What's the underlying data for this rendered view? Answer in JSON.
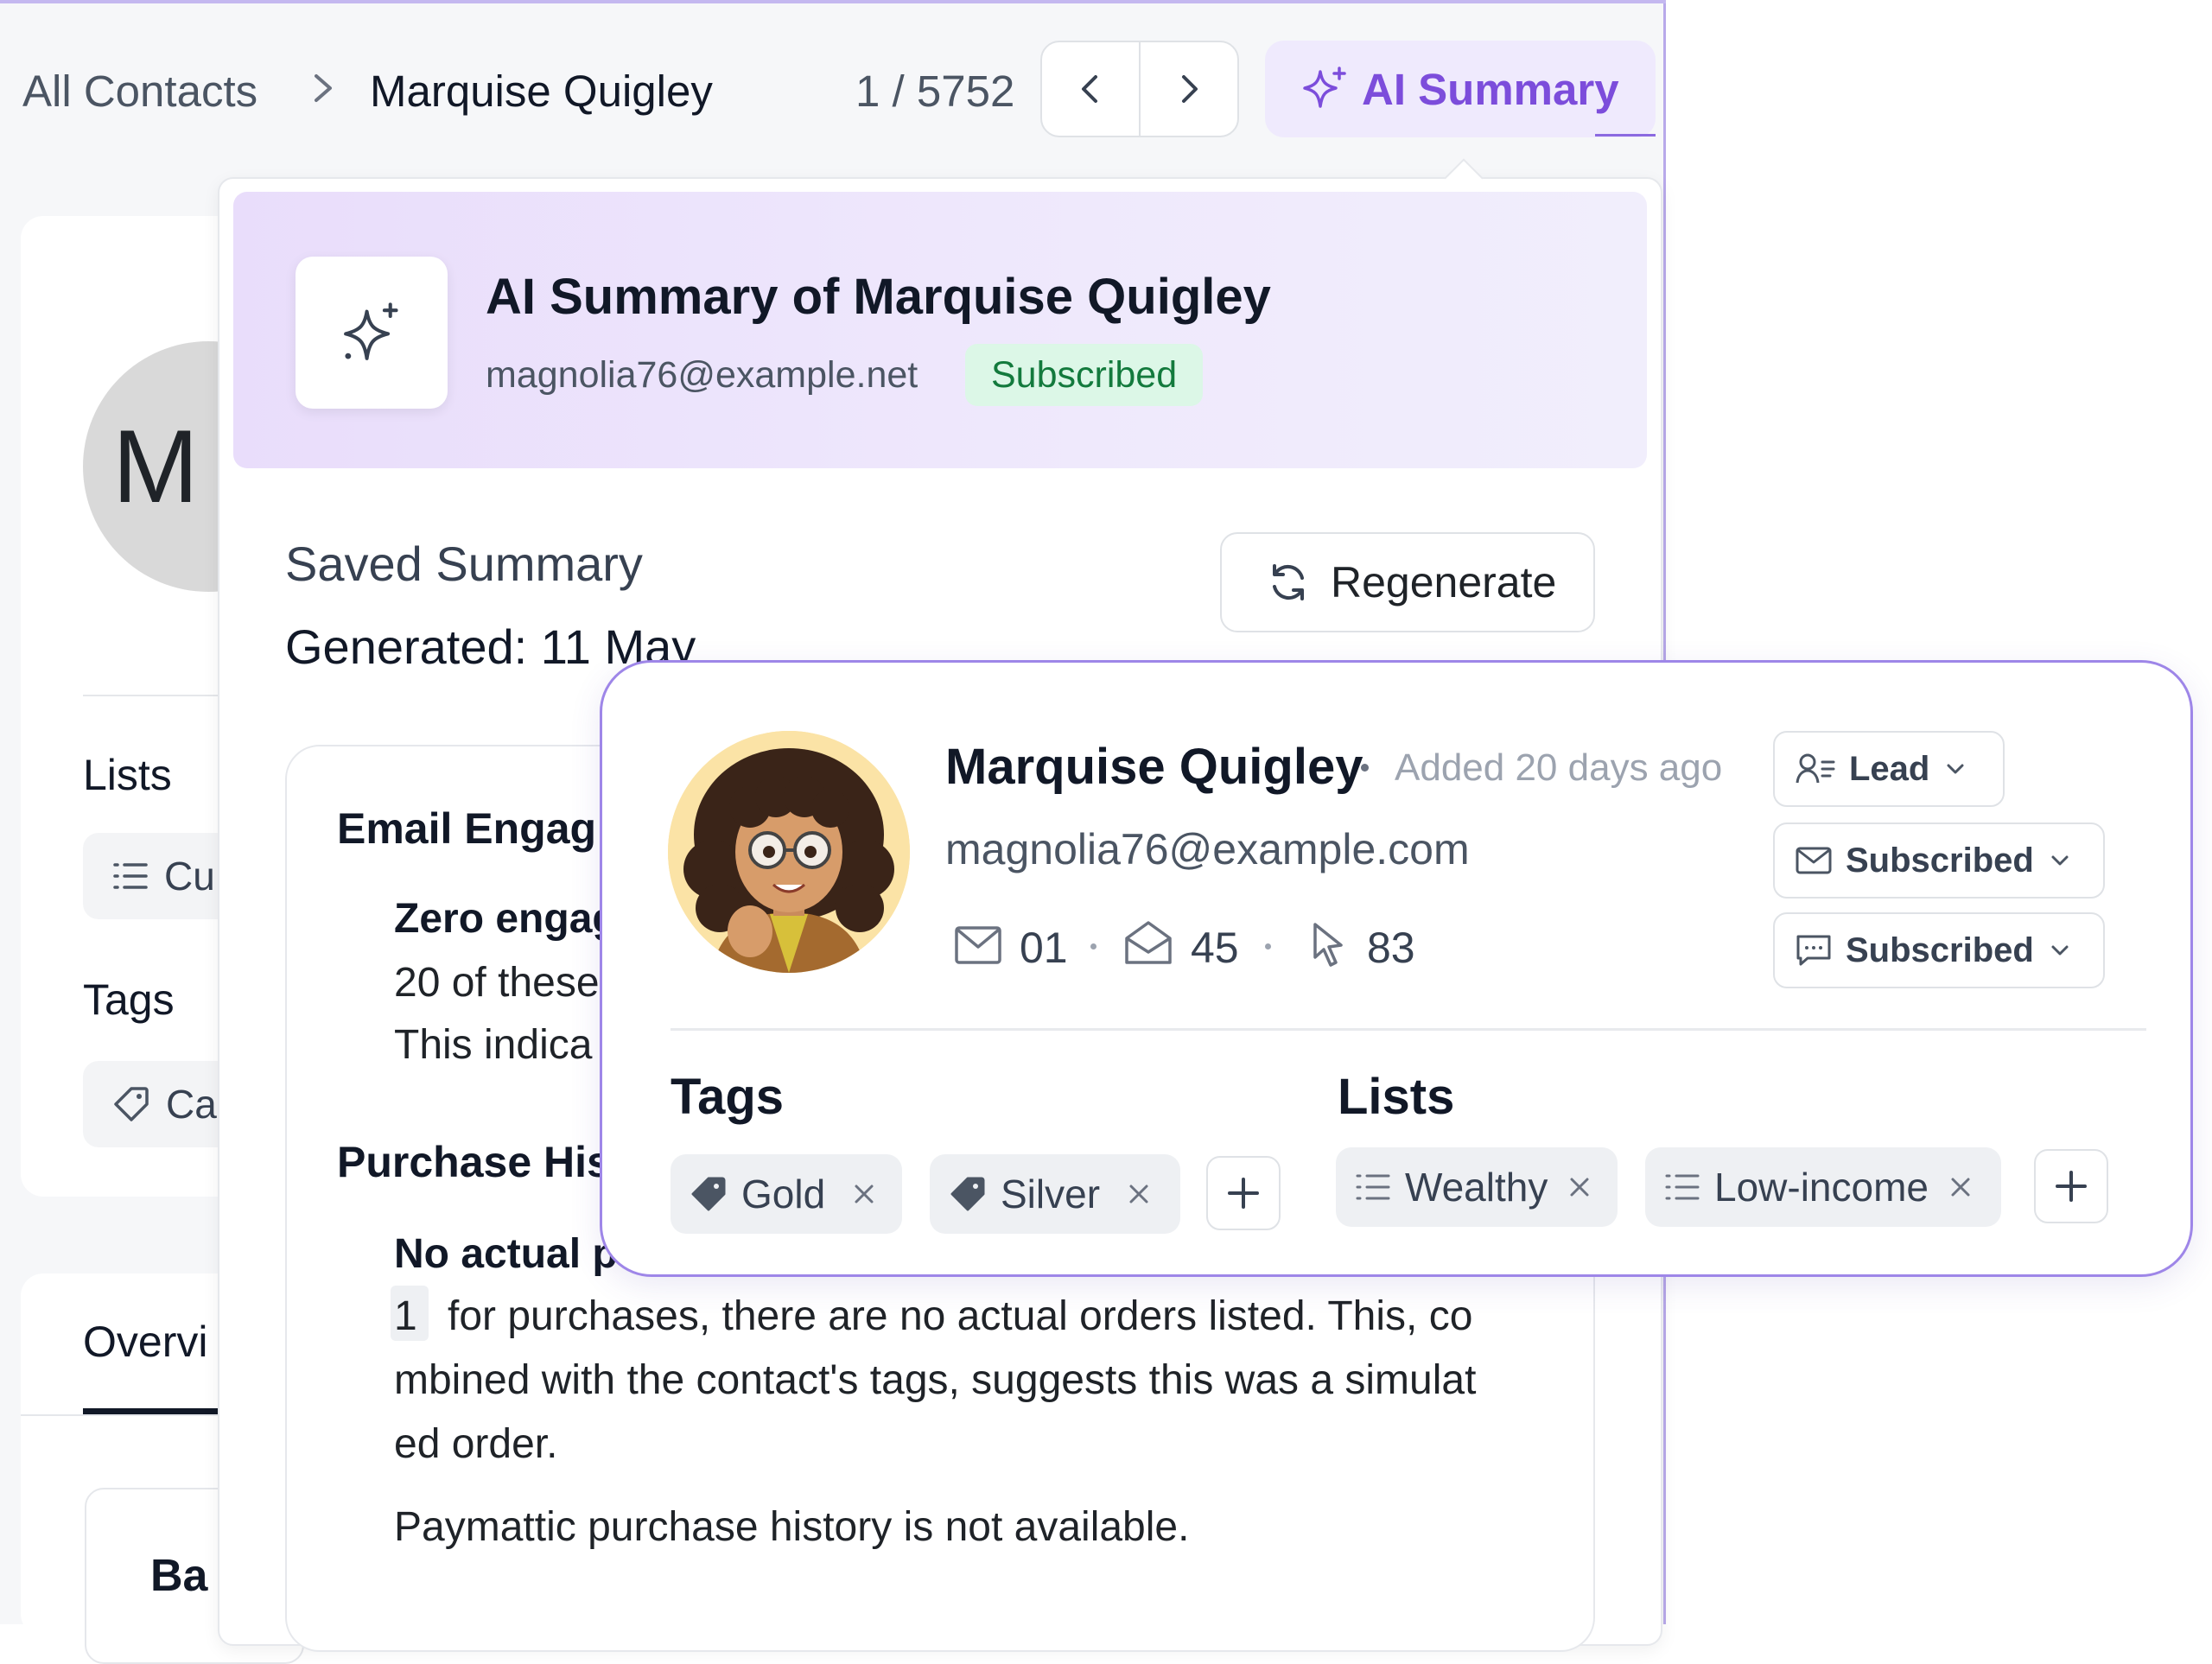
{
  "breadcrumb": {
    "root": "All Contacts",
    "current": "Marquise Quigley"
  },
  "pager": {
    "count": "1 / 5752"
  },
  "ai_button": {
    "label": "AI Summary"
  },
  "left_panel": {
    "avatar_letter": "M",
    "lists_heading": "Lists",
    "lists_chip": "Cu",
    "tags_heading": "Tags",
    "tags_chip": "Ca",
    "tab_overview": "Overvi",
    "basic_title": "Ba"
  },
  "summary": {
    "title": "AI Summary of Marquise Quigley",
    "email": "magnolia76@example.net",
    "status_badge": "Subscribed",
    "saved_title": "Saved Summary",
    "generated": "Generated: 11 May",
    "regenerate_label": "Regenerate",
    "sections": {
      "email_engagement_title": "Email Engag",
      "zero_engagement": "Zero engag",
      "line1": "20 of these",
      "line2": "This indica",
      "purchase_title": "Purchase His",
      "no_actual": "No actual p",
      "footnote": "1",
      "para1": "for purchases, there are no actual orders listed. This, co",
      "para2": "mbined with the contact's tags, suggests this was a simulat",
      "para3": "ed order.",
      "paymattic": "Paymattic purchase history is not available."
    }
  },
  "contact": {
    "name": "Marquise Quigley",
    "added": "Added 20 days ago",
    "email": "magnolia76@example.com",
    "stats": {
      "sent": "01",
      "opened": "45",
      "clicked": "83"
    },
    "dropdowns": [
      {
        "label": "Lead",
        "icon": "user-list-icon"
      },
      {
        "label": "Subscribed",
        "icon": "mail-icon"
      },
      {
        "label": "Subscribed",
        "icon": "sms-icon"
      }
    ],
    "tags_heading": "Tags",
    "lists_heading": "Lists",
    "tags": [
      "Gold",
      "Silver"
    ],
    "lists": [
      "Wealthy",
      "Low-income"
    ]
  },
  "colors": {
    "accent": "#7c4ddb",
    "accent_bg": "#efeafd",
    "badge_bg": "#dcf7e7",
    "badge_text": "#137a3d",
    "card_border": "#9e86e8"
  }
}
